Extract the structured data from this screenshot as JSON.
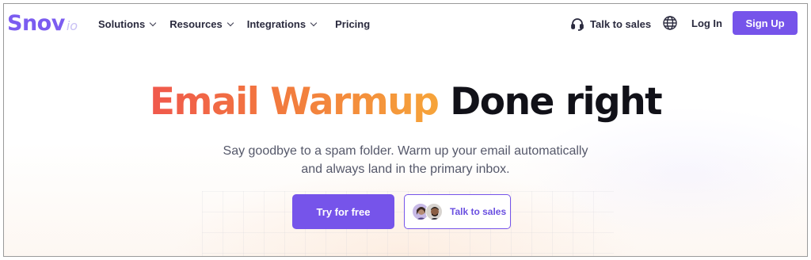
{
  "brand": {
    "logo_main": "Snov",
    "logo_suffix": "io"
  },
  "nav": {
    "menu": [
      {
        "label": "Solutions",
        "has_dropdown": true
      },
      {
        "label": "Resources",
        "has_dropdown": true
      },
      {
        "label": "Integrations",
        "has_dropdown": true
      },
      {
        "label": "Pricing",
        "has_dropdown": false
      }
    ],
    "talk_to_sales": "Talk to sales",
    "language_icon": "globe-icon",
    "login": "Log In",
    "signup": "Sign Up"
  },
  "hero": {
    "headline_accent": "Email Warmup",
    "headline_rest": "Done right",
    "subtitle_line1": "Say goodbye to a spam folder. Warm up your email automatically",
    "subtitle_line2": "and always land in the primary inbox.",
    "primary_cta": "Try for free",
    "secondary_cta": "Talk to sales"
  },
  "colors": {
    "brand_purple": "#7654ea",
    "headline_gradient_start": "#f0584c",
    "headline_gradient_end": "#f6a43a",
    "headline_dark": "#111118",
    "text_muted": "#55586a"
  }
}
